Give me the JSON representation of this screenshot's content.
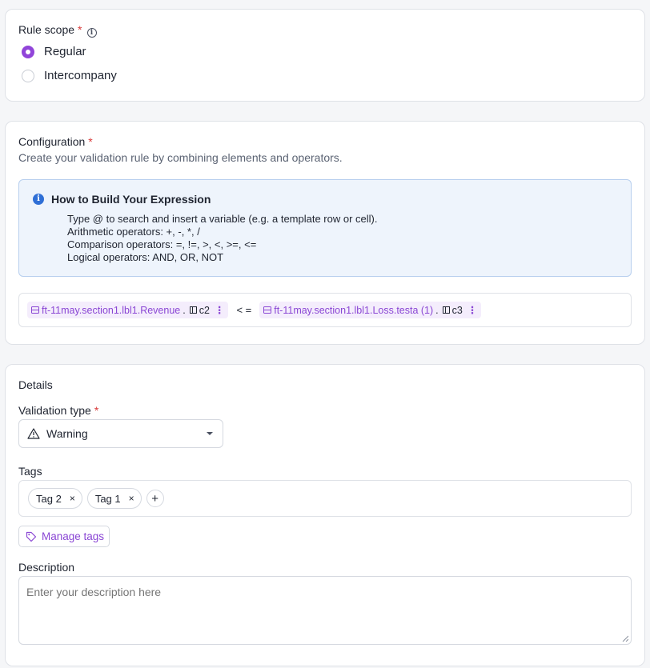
{
  "rule_scope": {
    "label": "Rule scope",
    "required_mark": "*",
    "info_glyph": "i",
    "options": [
      {
        "label": "Regular",
        "selected": true
      },
      {
        "label": "Intercompany",
        "selected": false
      }
    ]
  },
  "configuration": {
    "label": "Configuration",
    "required_mark": "*",
    "description": "Create your validation rule by combining elements and operators.",
    "howto": {
      "icon_glyph": "i",
      "title": "How to Build Your Expression",
      "lines": [
        "Type @ to search and insert a variable (e.g. a template row or cell).",
        "Arithmetic operators: +, -, *, /",
        "Comparison operators: =, !=, >, <, >=, <=",
        "Logical operators: AND, OR, NOT"
      ]
    },
    "expression": {
      "left": {
        "variable": "ft-11may.section1.lbl1.Revenue",
        "separator": ".",
        "cell": "c2",
        "menu": "⋮"
      },
      "operator": "< =",
      "right": {
        "variable": "ft-11may.section1.lbl1.Loss.testa (1)",
        "separator": ".",
        "cell": "c3",
        "menu": "⋮"
      }
    }
  },
  "details": {
    "title": "Details",
    "validation_type": {
      "label": "Validation type",
      "required_mark": "*",
      "value": "Warning",
      "icon": "warning-triangle-icon"
    },
    "tags": {
      "label": "Tags",
      "items": [
        {
          "label": "Tag 2",
          "remove": "×"
        },
        {
          "label": "Tag 1",
          "remove": "×"
        }
      ],
      "add": "+"
    },
    "manage_tags": "Manage tags",
    "description": {
      "label": "Description",
      "placeholder": "Enter your description here"
    }
  },
  "colors": {
    "accent": "#9145d9",
    "required": "#d93a3a",
    "info_bg": "#eef4fc",
    "info_border": "#b8cfee"
  }
}
